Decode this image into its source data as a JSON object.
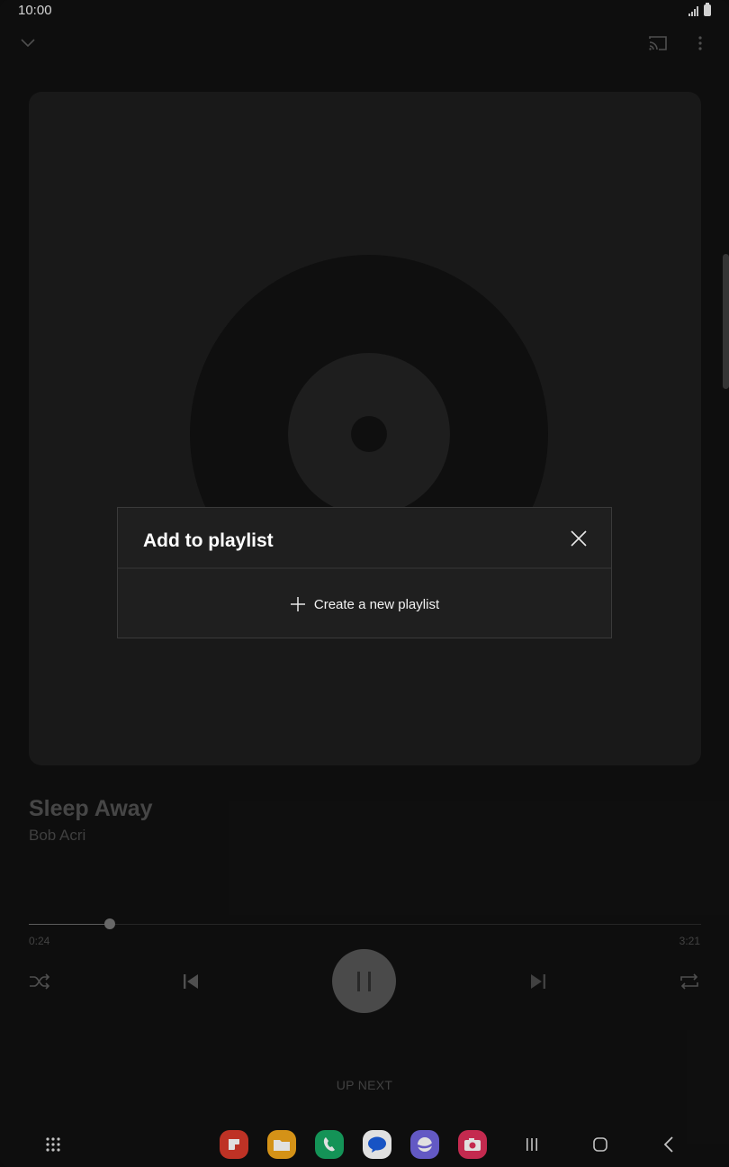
{
  "status_bar": {
    "time": "10:00"
  },
  "top_bar": {
    "collapse_icon": "chevron-down-icon",
    "cast_icon": "cast-icon",
    "more_icon": "more-vertical-icon"
  },
  "album_art": {
    "placeholder_icon": "vinyl-disc-icon"
  },
  "song": {
    "title": "Sleep Away",
    "artist": "Bob Acri"
  },
  "progress": {
    "elapsed": "0:24",
    "total": "3:21",
    "fraction": 0.12
  },
  "controls": {
    "shuffle_icon": "shuffle-icon",
    "previous_icon": "skip-previous-icon",
    "play_pause_icon": "pause-icon",
    "next_icon": "skip-next-icon",
    "repeat_icon": "repeat-icon"
  },
  "up_next_label": "UP NEXT",
  "dialog": {
    "title": "Add to playlist",
    "close_icon": "close-icon",
    "create_label": "Create a new playlist",
    "create_icon": "plus-icon"
  },
  "nav_bar": {
    "apps": [
      {
        "name": "app-red",
        "color": "#d93a2b"
      },
      {
        "name": "app-files",
        "color": "#f2a71b"
      },
      {
        "name": "app-phone",
        "color": "#17a864"
      },
      {
        "name": "app-messages",
        "color": "#ffffff"
      },
      {
        "name": "app-internet",
        "color": "#7166e0"
      },
      {
        "name": "app-camera",
        "color": "#e0305a"
      }
    ]
  }
}
